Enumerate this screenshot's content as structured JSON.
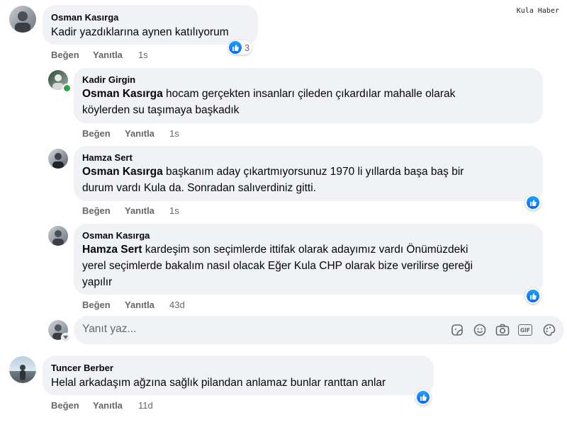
{
  "watermark": "Kula Haber",
  "actions": {
    "like": "Beğen",
    "reply": "Yanıtla"
  },
  "comments": [
    {
      "author": "Osman Kasırga",
      "text": "Kadir yazdıklarına aynen katılıyorum",
      "time": "1s",
      "reaction_count": "3"
    },
    {
      "author": "Kadir Girgin",
      "mention": "Osman Kasırga",
      "text_line1": " hocam gerçekten insanları çileden çıkardılar mahalle olarak",
      "text_line2": "köylerden su taşımaya başkadık",
      "time": "1s"
    },
    {
      "author": "Hamza Sert",
      "mention": "Osman Kasırga",
      "text_line1": " başkanım aday çıkartmıyorsunuz 1970 li yıllarda başa baş bir",
      "text_line2": "durum vardı Kula da. Sonradan salıverdiniz gitti.",
      "time": "1s"
    },
    {
      "author": "Osman Kasırga",
      "mention": "Hamza Sert",
      "text_line1": " kardeşim son seçimlerde ittifak olarak adayımız vardı Önümüzdeki",
      "text_line2": "yerel seçimlerde bakalım nasıl olacak Eğer Kula CHP olarak bize verilirse gereği",
      "text_line3": "yapılır",
      "time": "43d"
    },
    {
      "author": "Tuncer Berber",
      "text": "Helal arkadaşım ağzına sağlık pilandan anlamaz bunlar ranttan anlar",
      "time": "11d"
    }
  ],
  "reply_box": {
    "placeholder": "Yanıt yaz...",
    "tools": [
      "sticker-icon",
      "emoji-icon",
      "camera-icon",
      "gif-icon",
      "avatar-sticker-icon"
    ],
    "gif_label": "GIF"
  }
}
